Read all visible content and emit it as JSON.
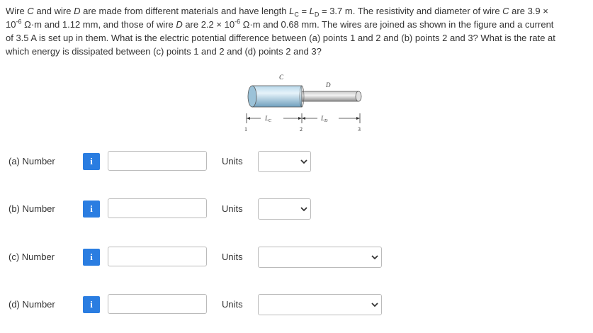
{
  "problem": {
    "line1_a": "Wire ",
    "line1_b": "C",
    "line1_c": " and wire ",
    "line1_d": "D",
    "line1_e": " are made from different materials and have length ",
    "line1_f": "L",
    "line1_f_sub": "C",
    "line1_g": " = ",
    "line1_h": "L",
    "line1_h_sub": "D",
    "line1_i": " = 3.7 m. The resistivity and diameter of wire ",
    "line1_j": "C",
    "line1_k": " are 3.9 ×",
    "line2_a": "10",
    "line2_sup": "-6",
    "line2_b": " Ω·m and 1.12 mm, and those of wire ",
    "line2_c": "D",
    "line2_d": " are 2.2 × 10",
    "line2_sup2": "-6",
    "line2_e": " Ω·m and 0.68 mm. The wires are joined as shown in the figure and a current",
    "line3": "of 3.5 A is set up in them. What is the electric potential difference between (a) points 1 and 2 and (b) points 2 and 3? What is the rate at",
    "line4": "which energy is dissipated between (c) points 1 and 2 and (d) points 2 and 3?"
  },
  "figure": {
    "label_C": "C",
    "label_D": "D",
    "label_LC": "L",
    "label_LC_sub": "C",
    "label_LD": "L",
    "label_LD_sub": "D",
    "point1": "1",
    "point2": "2",
    "point3": "3"
  },
  "answers": [
    {
      "label": "(a)   Number",
      "info": "i",
      "value": "",
      "units_label": "Units",
      "units_value": ""
    },
    {
      "label": "(b)   Number",
      "info": "i",
      "value": "",
      "units_label": "Units",
      "units_value": ""
    },
    {
      "label": "(c)   Number",
      "info": "i",
      "value": "",
      "units_label": "Units",
      "units_value": ""
    },
    {
      "label": "(d)   Number",
      "info": "i",
      "value": "",
      "units_label": "Units",
      "units_value": ""
    }
  ],
  "colors": {
    "info_button": "#2a7de1",
    "text": "#333333",
    "border": "#bbbbbb"
  }
}
